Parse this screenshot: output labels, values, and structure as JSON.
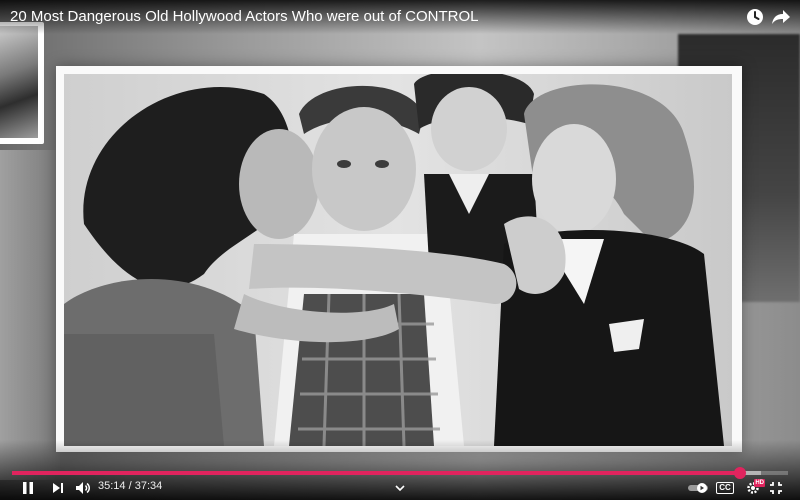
{
  "video": {
    "title": "20 Most Dangerous Old Hollywood Actors Who were out of CONTROL",
    "current_time": "35:14",
    "separator": "/",
    "duration": "37:34",
    "progress_fraction": 0.938,
    "buffered_fraction": 0.965,
    "accent_color": "#e0245e",
    "hd_badge": "HD"
  },
  "top_controls": {
    "watch_later_icon": "clock-icon",
    "share_icon": "share-arrow-icon"
  },
  "bottom_controls": {
    "play_pause_icon": "pause-icon",
    "next_icon": "next-icon",
    "volume_icon": "volume-icon",
    "chapters_icon": "chevron-down-icon",
    "autoplay_icon": "autoplay-toggle-icon",
    "captions_label": "CC",
    "settings_icon": "gear-icon",
    "fullscreen_icon": "exit-fullscreen-icon"
  }
}
